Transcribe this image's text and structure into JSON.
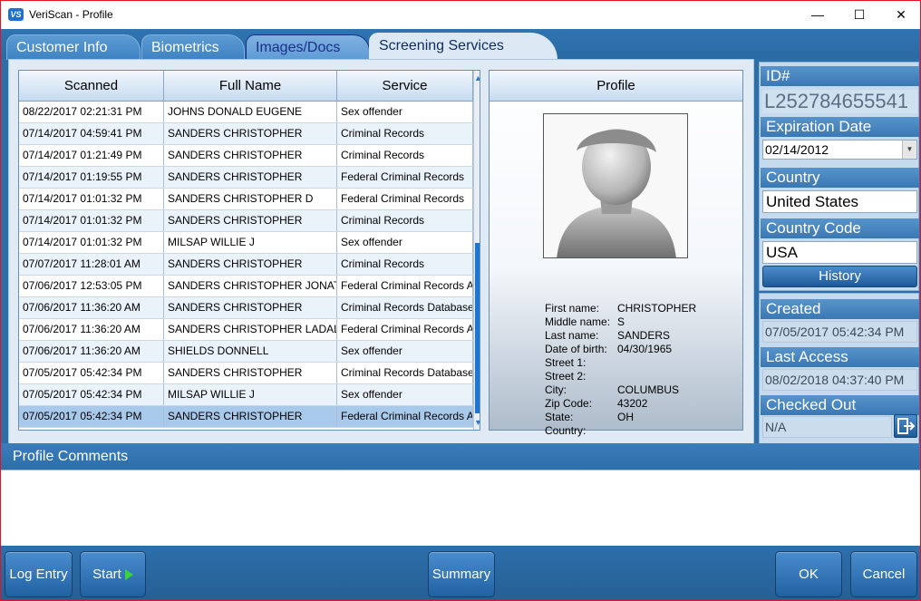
{
  "window": {
    "app_icon_text": "VS",
    "title": "VeriScan - Profile",
    "minimize": "—",
    "maximize": "☐",
    "close": "✕"
  },
  "tabs": [
    {
      "label": "Customer Info"
    },
    {
      "label": "Biometrics"
    },
    {
      "label": "Images/Docs"
    },
    {
      "label": "Screening Services"
    }
  ],
  "table": {
    "columns": [
      "Scanned",
      "Full Name",
      "Service"
    ],
    "rows": [
      {
        "scanned": "08/22/2017 02:21:31 PM",
        "name": "JOHNS DONALD EUGENE",
        "service": "Sex offender"
      },
      {
        "scanned": "07/14/2017 04:59:41 PM",
        "name": "SANDERS CHRISTOPHER",
        "service": "Criminal Records"
      },
      {
        "scanned": "07/14/2017 01:21:49 PM",
        "name": "SANDERS CHRISTOPHER",
        "service": "Criminal Records"
      },
      {
        "scanned": "07/14/2017 01:19:55 PM",
        "name": "SANDERS CHRISTOPHER",
        "service": "Federal Criminal Records"
      },
      {
        "scanned": "07/14/2017 01:01:32 PM",
        "name": "SANDERS CHRISTOPHER D",
        "service": "Federal Criminal Records"
      },
      {
        "scanned": "07/14/2017 01:01:32 PM",
        "name": "SANDERS CHRISTOPHER",
        "service": "Criminal Records"
      },
      {
        "scanned": "07/14/2017 01:01:32 PM",
        "name": "MILSAP WILLIE J",
        "service": "Sex offender"
      },
      {
        "scanned": "07/07/2017 11:28:01 AM",
        "name": "SANDERS CHRISTOPHER",
        "service": "Criminal Records"
      },
      {
        "scanned": "07/06/2017 12:53:05 PM",
        "name": "SANDERS CHRISTOPHER JONATH",
        "service": "Federal Criminal Records AP"
      },
      {
        "scanned": "07/06/2017 11:36:20 AM",
        "name": "SANDERS CHRISTOPHER",
        "service": "Criminal Records Database"
      },
      {
        "scanned": "07/06/2017 11:36:20 AM",
        "name": "SANDERS CHRISTOPHER LADALE",
        "service": "Federal Criminal Records AP"
      },
      {
        "scanned": "07/06/2017 11:36:20 AM",
        "name": "SHIELDS DONNELL",
        "service": "Sex offender"
      },
      {
        "scanned": "07/05/2017 05:42:34 PM",
        "name": "SANDERS CHRISTOPHER",
        "service": "Criminal Records Database"
      },
      {
        "scanned": "07/05/2017 05:42:34 PM",
        "name": "MILSAP WILLIE J",
        "service": "Sex offender"
      },
      {
        "scanned": "07/05/2017 05:42:34 PM",
        "name": "SANDERS CHRISTOPHER",
        "service": "Federal Criminal Records AP"
      }
    ],
    "selected_row": 14
  },
  "profile": {
    "header": "Profile",
    "fields": [
      {
        "label": "First name:",
        "value": "CHRISTOPHER"
      },
      {
        "label": "Middle name:",
        "value": "S"
      },
      {
        "label": "Last name:",
        "value": "SANDERS"
      },
      {
        "label": "Date of birth:",
        "value": "04/30/1965"
      },
      {
        "label": "Street 1:",
        "value": ""
      },
      {
        "label": "Street 2:",
        "value": ""
      },
      {
        "label": "City:",
        "value": "COLUMBUS"
      },
      {
        "label": "Zip Code:",
        "value": "43202"
      },
      {
        "label": "State:",
        "value": "OH"
      },
      {
        "label": "Country:",
        "value": ""
      }
    ]
  },
  "sidebar": {
    "id_label": "ID#",
    "id_value": "L252784655541",
    "expiration_label": "Expiration Date",
    "expiration_value": "02/14/2012",
    "country_label": "Country",
    "country_value": "United States",
    "country_code_label": "Country Code",
    "country_code_value": "USA",
    "history_button": "History",
    "created_label": "Created",
    "created_value": "07/05/2017 05:42:34 PM",
    "last_access_label": "Last Access",
    "last_access_value": "08/02/2018 04:37:40 PM",
    "checked_out_label": "Checked Out",
    "checked_out_value": "N/A"
  },
  "comments": {
    "label": "Profile Comments",
    "value": ""
  },
  "buttons": {
    "log_entry": "Log Entry",
    "start": "Start",
    "summary": "Summary",
    "ok": "OK",
    "cancel": "Cancel"
  },
  "colors": {
    "accent": "#2c6ea8",
    "selected_row": "#a9c9ea",
    "start_arrow": "#38d43a"
  }
}
